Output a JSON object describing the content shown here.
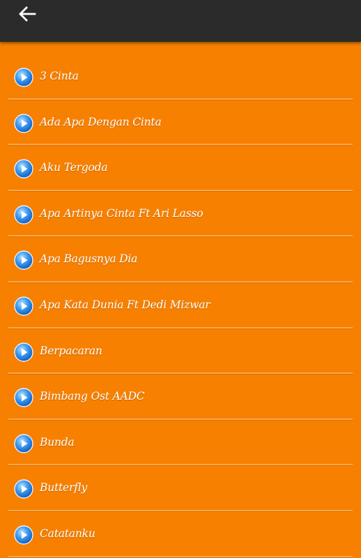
{
  "app_bar": {
    "back_icon": "arrow-left-icon",
    "background": "#2b2b2b"
  },
  "colors": {
    "list_background": "#f78000",
    "divider": "#ffa64a",
    "play_icon": "#1f7fe0"
  },
  "songs": [
    {
      "label": "3 Cinta",
      "icon": "play-icon"
    },
    {
      "label": "Ada Apa Dengan Cinta",
      "icon": "play-icon"
    },
    {
      "label": "Aku Tergoda",
      "icon": "play-icon"
    },
    {
      "label": "Apa Artinya Cinta Ft Ari Lasso",
      "icon": "play-icon"
    },
    {
      "label": "Apa Bagusnya Dia",
      "icon": "play-icon"
    },
    {
      "label": "Apa Kata Dunia Ft Dedi Mizwar",
      "icon": "play-icon"
    },
    {
      "label": "Berpacaran",
      "icon": "play-icon"
    },
    {
      "label": "Bimbang Ost AADC",
      "icon": "play-icon"
    },
    {
      "label": "Bunda",
      "icon": "play-icon"
    },
    {
      "label": "Butterfly",
      "icon": "play-icon"
    },
    {
      "label": "Catatanku",
      "icon": "play-icon"
    }
  ]
}
